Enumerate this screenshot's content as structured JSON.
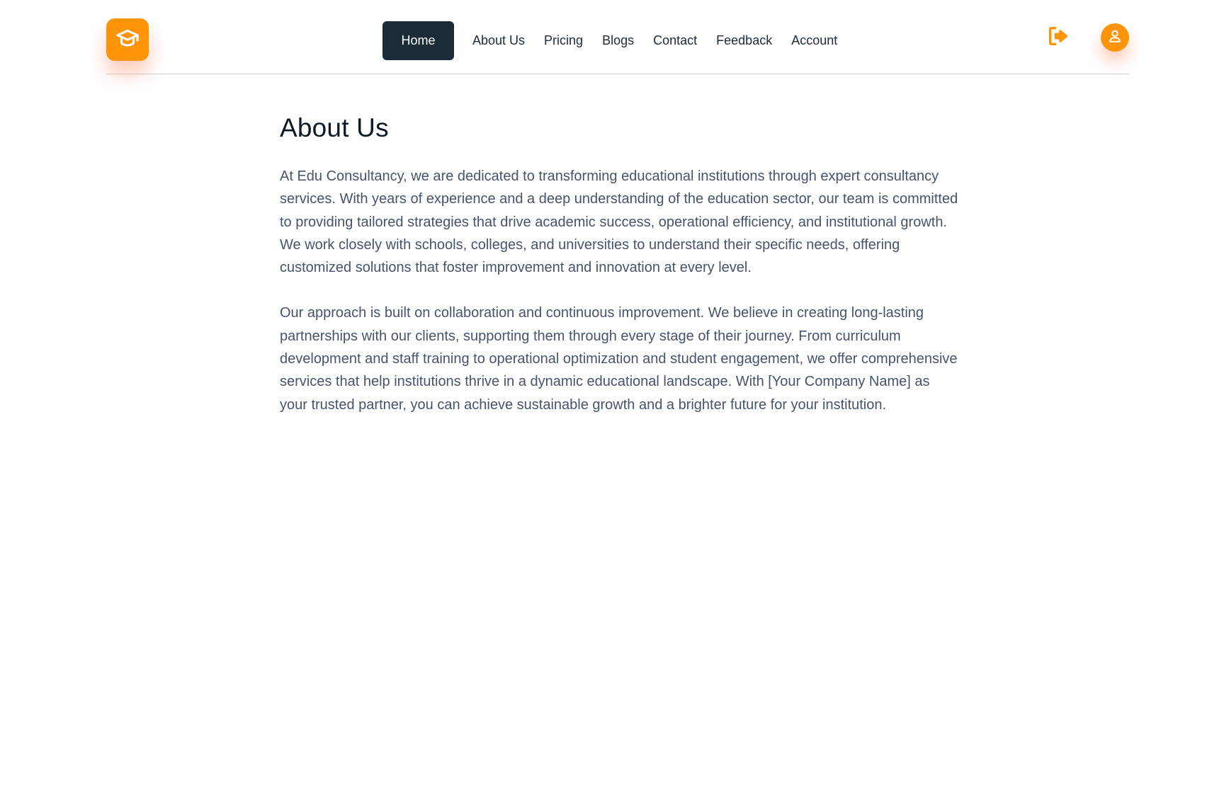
{
  "brand": {
    "logo_icon": "graduation-cap-icon",
    "accent_color": "#ff9408"
  },
  "nav": {
    "items": [
      {
        "label": "Home",
        "active": true
      },
      {
        "label": "About Us",
        "active": false
      },
      {
        "label": "Pricing",
        "active": false
      },
      {
        "label": "Blogs",
        "active": false
      },
      {
        "label": "Contact",
        "active": false
      },
      {
        "label": "Feedback",
        "active": false
      },
      {
        "label": "Account",
        "active": false
      }
    ],
    "active_bg_color": "#1b2c39"
  },
  "header_actions": {
    "logout_icon": "logout-icon",
    "profile_icon": "user-icon"
  },
  "main": {
    "title": "About Us",
    "paragraphs": [
      "At Edu Consultancy, we are dedicated to transforming educational institutions through expert consultancy services. With years of experience and a deep understanding of the education sector, our team is committed to providing tailored strategies that drive academic success, operational efficiency, and institutional growth. We work closely with schools, colleges, and universities to understand their specific needs, offering customized solutions that foster improvement and innovation at every level.",
      "Our approach is built on collaboration and continuous improvement. We believe in creating long-lasting partnerships with our clients, supporting them through every stage of their journey. From curriculum development and staff training to operational optimization and student engagement, we offer comprehensive services that help institutions thrive in a dynamic educational landscape. With [Your Company Name] as your trusted partner, you can achieve sustainable growth and a brighter future for your institution."
    ]
  }
}
